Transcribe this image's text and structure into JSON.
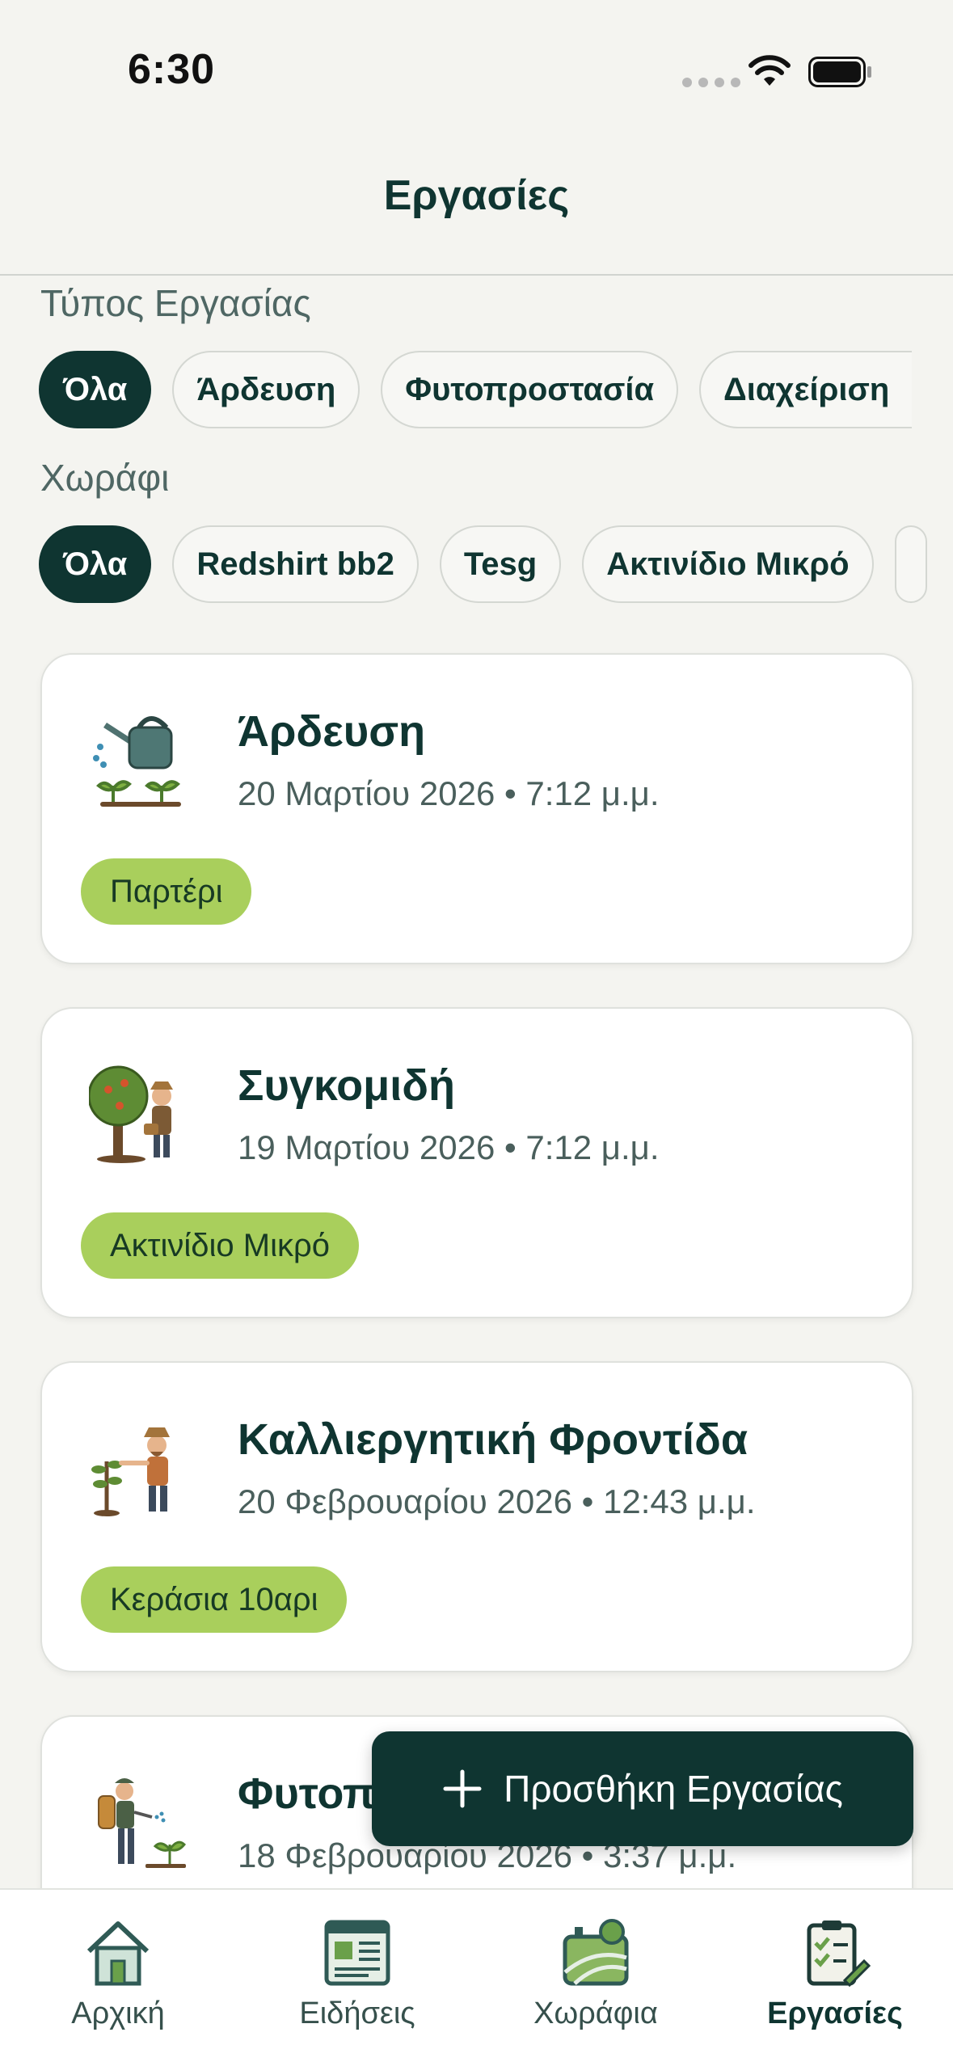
{
  "status_bar": {
    "time": "6:30"
  },
  "nav": {
    "title": "Εργασίες"
  },
  "filters": {
    "task_type": {
      "label": "Τύπος Εργασίας",
      "chips": [
        "Όλα",
        "Άρδευση",
        "Φυτοπροστασία",
        "Διαχείριση"
      ],
      "selected": "Όλα"
    },
    "field": {
      "label": "Χωράφι",
      "chips": [
        "Όλα",
        "Redshirt bb2",
        "Tesg",
        "Ακτινίδιο Μικρό"
      ],
      "selected": "Όλα"
    }
  },
  "tasks": [
    {
      "title": "Άρδευση",
      "date": "20 Μαρτίου 2026",
      "time": "7:12 μ.μ.",
      "field": "Παρτέρι",
      "icon": "watering-can-icon"
    },
    {
      "title": "Συγκομιδή",
      "date": "19 Μαρτίου 2026",
      "time": "7:12 μ.μ.",
      "field": "Ακτινίδιο Μικρό",
      "icon": "harvest-icon"
    },
    {
      "title": "Καλλιεργητική Φροντίδα",
      "date": "20 Φεβρουαρίου 2026",
      "time": "12:43 μ.μ.",
      "field": "Κεράσια 10αρι",
      "icon": "farmer-care-icon"
    },
    {
      "title": "Φυτοπ",
      "date": "18 Φεβρουαρίου 2026",
      "time": "3:37 μ.μ.",
      "field": "",
      "icon": "sprayer-icon"
    }
  ],
  "fab": {
    "label": "Προσθήκη Εργασίας"
  },
  "tab_bar": {
    "tabs": [
      {
        "label": "Αρχική",
        "icon": "home-icon"
      },
      {
        "label": "Ειδήσεις",
        "icon": "news-icon"
      },
      {
        "label": "Χωράφια",
        "icon": "fields-icon"
      },
      {
        "label": "Εργασίες",
        "icon": "tasks-icon"
      }
    ],
    "active": "Εργασίες"
  },
  "colors": {
    "primary": "#0f3531",
    "accent_tag": "#a9cf5c",
    "background": "#f4f4f0"
  }
}
